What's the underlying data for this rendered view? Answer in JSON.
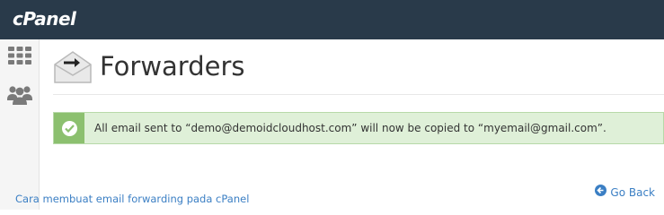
{
  "topbar": {
    "logo_text": "cPanel"
  },
  "sidebar": {
    "items": [
      {
        "icon": "apps-grid-icon"
      },
      {
        "icon": "users-icon"
      }
    ]
  },
  "header": {
    "title": "Forwarders",
    "icon": "envelope-arrow-icon"
  },
  "alert": {
    "type": "success",
    "icon": "check-circle-icon",
    "message": "All email sent to “demo@demoidcloudhost.com” will now be copied to “myemail@gmail.com”."
  },
  "actions": {
    "go_back_label": "Go Back",
    "go_back_icon": "arrow-left-circle-icon"
  },
  "footer": {
    "link_text": "Cara membuat email forwarding pada cPanel"
  },
  "colors": {
    "topbar": "#293a4a",
    "alert_bg": "#dff0d8",
    "alert_icon_bg": "#8cc06f",
    "link": "#3b7fc4"
  }
}
